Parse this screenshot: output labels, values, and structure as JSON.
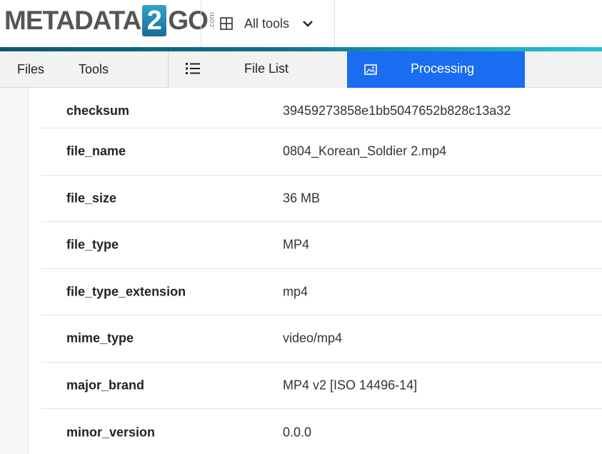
{
  "header": {
    "logo": {
      "part1": "METADATA",
      "part2": "2",
      "part3": "GO",
      "suffix": ".com"
    },
    "all_tools_label": "All tools"
  },
  "nav": {
    "files_label": "Files",
    "tools_label": "Tools",
    "file_list_label": "File List",
    "processing_label": "Processing"
  },
  "colors": {
    "active_tab": "#1a6cf0",
    "accent_start": "#0d5a70",
    "accent_end": "#26c2cf"
  },
  "metadata": [
    {
      "key": "checksum",
      "value": "39459273858e1bb5047652b828c13a32"
    },
    {
      "key": "file_name",
      "value": "0804_Korean_Soldier 2.mp4"
    },
    {
      "key": "file_size",
      "value": "36 MB"
    },
    {
      "key": "file_type",
      "value": "MP4"
    },
    {
      "key": "file_type_extension",
      "value": "mp4"
    },
    {
      "key": "mime_type",
      "value": "video/mp4"
    },
    {
      "key": "major_brand",
      "value": "MP4 v2 [ISO 14496-14]"
    },
    {
      "key": "minor_version",
      "value": "0.0.0"
    }
  ]
}
